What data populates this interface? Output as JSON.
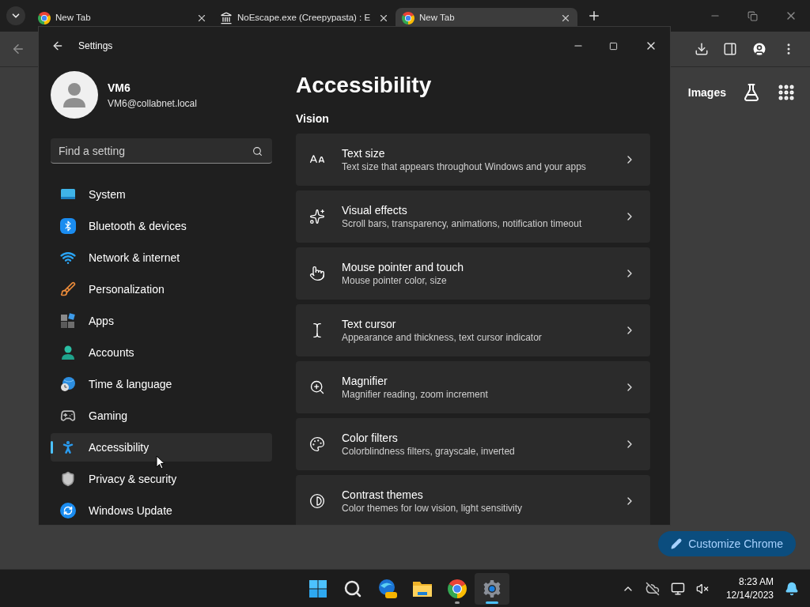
{
  "browser": {
    "tabs": [
      {
        "title": "New Tab",
        "kind": "newtab",
        "selected": false
      },
      {
        "title": "NoEscape.exe (Creepypasta) : E",
        "kind": "site",
        "selected": false
      },
      {
        "title": "New Tab",
        "kind": "newtab",
        "selected": true
      }
    ],
    "links": [
      "Images"
    ],
    "customize_button": "Customize Chrome"
  },
  "settings_window": {
    "title": "Settings",
    "user": {
      "name": "VM6",
      "email": "VM6@collabnet.local"
    },
    "search": {
      "placeholder": "Find a setting"
    },
    "nav": [
      {
        "label": "System",
        "kind": "system",
        "selected": false
      },
      {
        "label": "Bluetooth & devices",
        "kind": "bluetooth",
        "selected": false
      },
      {
        "label": "Network & internet",
        "kind": "network",
        "selected": false
      },
      {
        "label": "Personalization",
        "kind": "personalization",
        "selected": false
      },
      {
        "label": "Apps",
        "kind": "apps",
        "selected": false
      },
      {
        "label": "Accounts",
        "kind": "accounts",
        "selected": false
      },
      {
        "label": "Time & language",
        "kind": "time",
        "selected": false
      },
      {
        "label": "Gaming",
        "kind": "gaming",
        "selected": false
      },
      {
        "label": "Accessibility",
        "kind": "accessibility",
        "selected": true
      },
      {
        "label": "Privacy & security",
        "kind": "privacy",
        "selected": false
      },
      {
        "label": "Windows Update",
        "kind": "update",
        "selected": false
      }
    ],
    "heading": "Accessibility",
    "section": "Vision",
    "cards": [
      {
        "title": "Text size",
        "subtitle": "Text size that appears throughout Windows and your apps",
        "kind": "text-size"
      },
      {
        "title": "Visual effects",
        "subtitle": "Scroll bars, transparency, animations, notification timeout",
        "kind": "effects"
      },
      {
        "title": "Mouse pointer and touch",
        "subtitle": "Mouse pointer color, size",
        "kind": "pointer"
      },
      {
        "title": "Text cursor",
        "subtitle": "Appearance and thickness, text cursor indicator",
        "kind": "cursor"
      },
      {
        "title": "Magnifier",
        "subtitle": "Magnifier reading, zoom increment",
        "kind": "magnifier"
      },
      {
        "title": "Color filters",
        "subtitle": "Colorblindness filters, grayscale, inverted",
        "kind": "filters"
      },
      {
        "title": "Contrast themes",
        "subtitle": "Color themes for low vision, light sensitivity",
        "kind": "contrast"
      }
    ]
  },
  "taskbar": {
    "apps": [
      {
        "kind": "start",
        "selected": false,
        "running": false
      },
      {
        "kind": "search",
        "selected": false,
        "running": false
      },
      {
        "kind": "edge",
        "selected": false,
        "running": false
      },
      {
        "kind": "files",
        "selected": false,
        "running": false
      },
      {
        "kind": "chrome",
        "selected": false,
        "running": true
      },
      {
        "kind": "settings",
        "selected": true,
        "running": true
      }
    ],
    "time": "8:23 AM",
    "date": "12/14/2023"
  }
}
